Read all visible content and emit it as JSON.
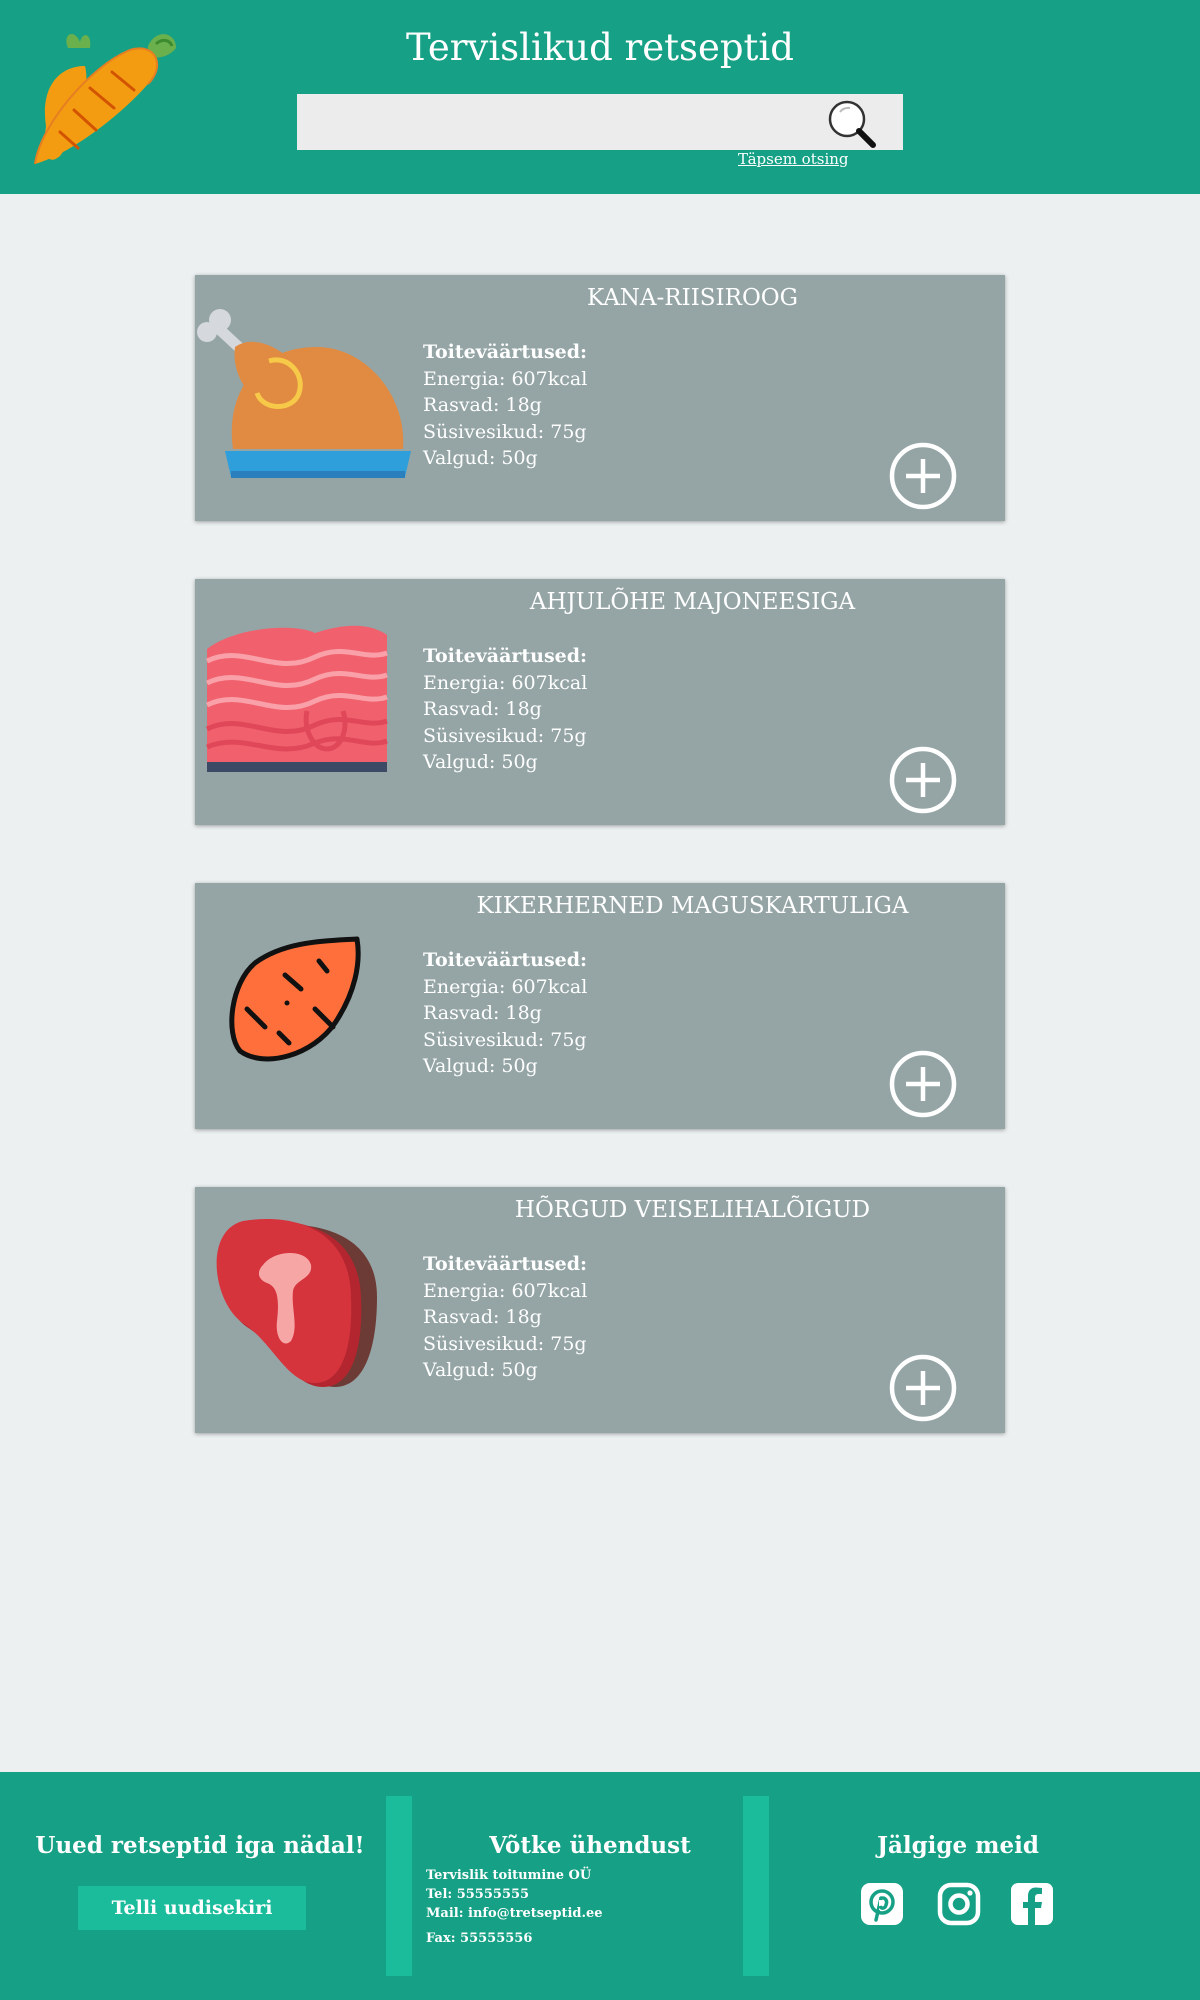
{
  "header": {
    "title": "Tervislikud retseptid",
    "search_placeholder": "",
    "advanced_search": "Täpsem otsing"
  },
  "recipes": [
    {
      "title": "KANA-RIISIROOG",
      "image_icon": "roast-chicken-icon",
      "nutrition_heading": "Toiteväärtused:",
      "energy": "Energia:  607kcal",
      "fat": "Rasvad: 18g",
      "carbs": "Süsivesikud: 75g",
      "protein": "Valgud: 50g"
    },
    {
      "title": "AHJULÕHE MAJONEESIGA",
      "image_icon": "salmon-fillet-icon",
      "nutrition_heading": "Toiteväärtused:",
      "energy": "Energia:  607kcal",
      "fat": "Rasvad: 18g",
      "carbs": "Süsivesikud: 75g",
      "protein": "Valgud: 50g"
    },
    {
      "title": "KIKERHERNED MAGUSKARTULIGA",
      "image_icon": "sweet-potato-icon",
      "nutrition_heading": "Toiteväärtused:",
      "energy": "Energia:  607kcal",
      "fat": "Rasvad: 18g",
      "carbs": "Süsivesikud: 75g",
      "protein": "Valgud: 50g"
    },
    {
      "title": "HÕRGUD VEISELIHALÕIGUD",
      "image_icon": "beef-steak-icon",
      "nutrition_heading": "Toiteväärtused:",
      "energy": "Energia:  607kcal",
      "fat": "Rasvad: 18g",
      "carbs": "Süsivesikud: 75g",
      "protein": "Valgud: 50g"
    }
  ],
  "footer": {
    "newsletter_title": "Uued retseptid iga nädal!",
    "newsletter_button": "Telli uudisekiri",
    "contact_title": "Võtke ühendust",
    "contact_company": "Tervislik toitumine OÜ",
    "contact_phone": "Tel: 55555555",
    "contact_mail": "Mail: info@tretseptid.ee",
    "contact_fax": "Fax: 55555556",
    "follow_title": "Jälgige meid",
    "social_icons": [
      "pinterest-icon",
      "instagram-icon",
      "facebook-icon"
    ]
  },
  "colors": {
    "primary": "#16a085",
    "accent": "#1abc9c",
    "card": "#95a5a6",
    "background": "#ecf0f1"
  }
}
